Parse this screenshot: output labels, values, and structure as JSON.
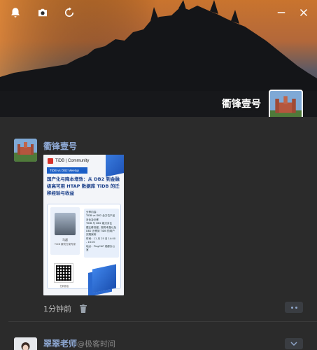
{
  "topbar": {
    "icons": [
      "bell-icon",
      "camera-icon",
      "refresh-icon",
      "minimize-icon",
      "close-icon"
    ]
  },
  "cover": {
    "name": "衢锋壹号"
  },
  "post": {
    "author": "衢锋壹号",
    "poster": {
      "brand": "TiDB | Community",
      "banner": "TiDB vs DB2 Meetup",
      "title": "国产化与降本增效：从 DB2 到金融级高可用 HTAP 数据库 TiDB 的迁移经验与收益",
      "speaker_name": "马超",
      "speaker_role": "TiDB 解决方案专家",
      "info": "分享内容：\nTiDB vs DB2 全方位产品对比及迁移\nTiDB 与 DB2 能力对比\n建迁移流程、服务考量以及\nDB2 迁移到 TiDB 的用户实践案例\n时间：11 月 25 日 14:00 - 16:00\n地点：PingCAP 成都办公室",
      "qr_label": "扫码报名"
    },
    "time": "1分钟前"
  },
  "post2": {
    "author": "翠翠老师",
    "source": "@极客时间"
  },
  "colors": {
    "background": "#2b2b2b",
    "name_accent": "#8ea8d3",
    "poster_blue": "#1b5fc7"
  }
}
